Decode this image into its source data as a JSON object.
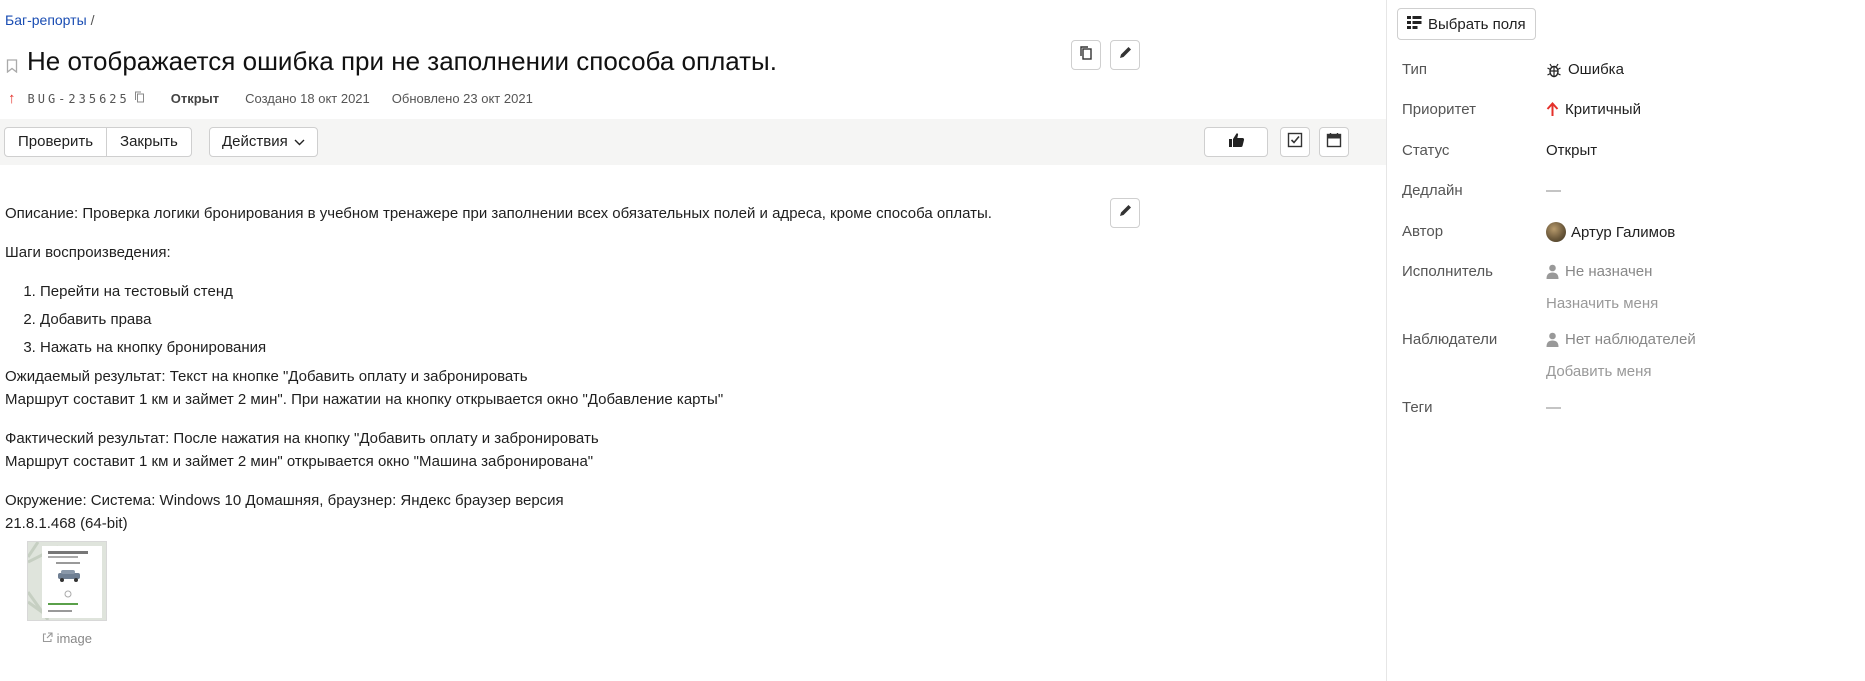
{
  "breadcrumb": {
    "link": "Баг-репорты",
    "separator": "/"
  },
  "issue": {
    "title": "Не отображается ошибка при не заполнении способа оплаты.",
    "key": "BUG-235625",
    "status": "Открыт",
    "created": "Создано 18 окт 2021",
    "updated": "Обновлено 23 окт 2021"
  },
  "toolbar": {
    "check_label": "Проверить",
    "close_label": "Закрыть",
    "actions_label": "Действия"
  },
  "description": {
    "desc": "Описание: Проверка логики бронирования в учебном тренажере при заполнении всех обязательных полей и адреса, кроме способа оплаты.",
    "steps_title": "Шаги воспроизведения:",
    "steps": [
      "Перейти на тестовый стенд",
      "Добавить права",
      "Нажать на кнопку бронирования"
    ],
    "expected_1": "Ожидаемый результат: Текст на кнопке \"Добавить оплату и забронировать",
    "expected_2": "Маршрут составит 1 км и займет 2 мин\". При нажатии на кнопку открывается окно \"Добавление карты\"",
    "actual_1": "Фактический результат: После нажатия на кнопку \"Добавить оплату и забронировать",
    "actual_2": "Маршрут составит 1 км и займет 2 мин\" открывается окно \"Машина забронирована\"",
    "env_1": "Окружение: Система: Windows 10 Домашняя, браузнер: Яндекс браузер версия",
    "env_2": "21.8.1.468 (64-bit)",
    "attachment_caption": "image"
  },
  "sidebar": {
    "fields_button": "Выбрать поля",
    "type_label": "Тип",
    "type_value": "Ошибка",
    "priority_label": "Приоритет",
    "priority_value": "Критичный",
    "status_label": "Статус",
    "status_value": "Открыт",
    "deadline_label": "Дедлайн",
    "deadline_value": "—",
    "author_label": "Автор",
    "author_value": "Артур Галимов",
    "assignee_label": "Исполнитель",
    "assignee_value": "Не назначен",
    "assign_me": "Назначить меня",
    "watchers_label": "Наблюдатели",
    "watchers_value": "Нет наблюдателей",
    "add_me": "Добавить меня",
    "tags_label": "Теги",
    "tags_value": "—"
  },
  "colors": {
    "link": "#1a4db3",
    "priority_red": "#e4312b",
    "toolbar_bg": "#f5f5f4"
  },
  "icons": [
    "bookmark-icon",
    "copy-icon",
    "copy-key-icon",
    "edit-icon",
    "thumbs-up-icon",
    "checklist-icon",
    "calendar-icon",
    "bug-icon",
    "arrow-up-icon",
    "user-icon",
    "columns-icon",
    "external-link-icon",
    "chevron-down-icon"
  ]
}
